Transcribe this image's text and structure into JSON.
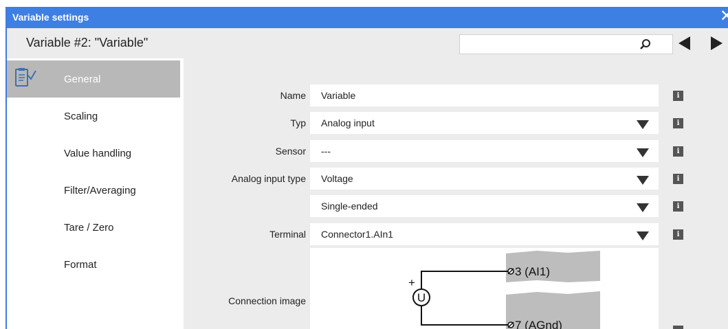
{
  "window": {
    "title": "Variable settings",
    "close_glyph": "✕"
  },
  "header": {
    "heading": "Variable #2: \"Variable\"",
    "search_value": "",
    "search_icon": "search-icon",
    "prev_icon": "previous-arrow-icon",
    "next_icon": "next-arrow-icon"
  },
  "sidebar": {
    "items": [
      {
        "label": "General",
        "active": true,
        "icon": "checklist-icon"
      },
      {
        "label": "Scaling"
      },
      {
        "label": "Value handling"
      },
      {
        "label": "Filter/Averaging"
      },
      {
        "label": "Tare / Zero"
      },
      {
        "label": "Format"
      }
    ]
  },
  "form": {
    "name": {
      "label": "Name",
      "value": "Variable"
    },
    "typ": {
      "label": "Typ",
      "value": "Analog input"
    },
    "sensor": {
      "label": "Sensor",
      "value": "---"
    },
    "analog_input_type": {
      "label": "Analog input type",
      "value": "Voltage"
    },
    "input_mode": {
      "label": "",
      "value": "Single-ended"
    },
    "terminal": {
      "label": "Terminal",
      "value": "Connector1.AIn1"
    },
    "connection_image": {
      "label": "Connection image",
      "terminal_top": "3 (AI1)",
      "terminal_bottom": "7 (AGnd)",
      "source_symbol": "U",
      "plus_sign": "+"
    }
  },
  "info_glyph": "i",
  "colors": {
    "titlebar": "#3e7fe3",
    "sidebar_active": "#b8b8b8",
    "content_bg": "#ececec"
  }
}
